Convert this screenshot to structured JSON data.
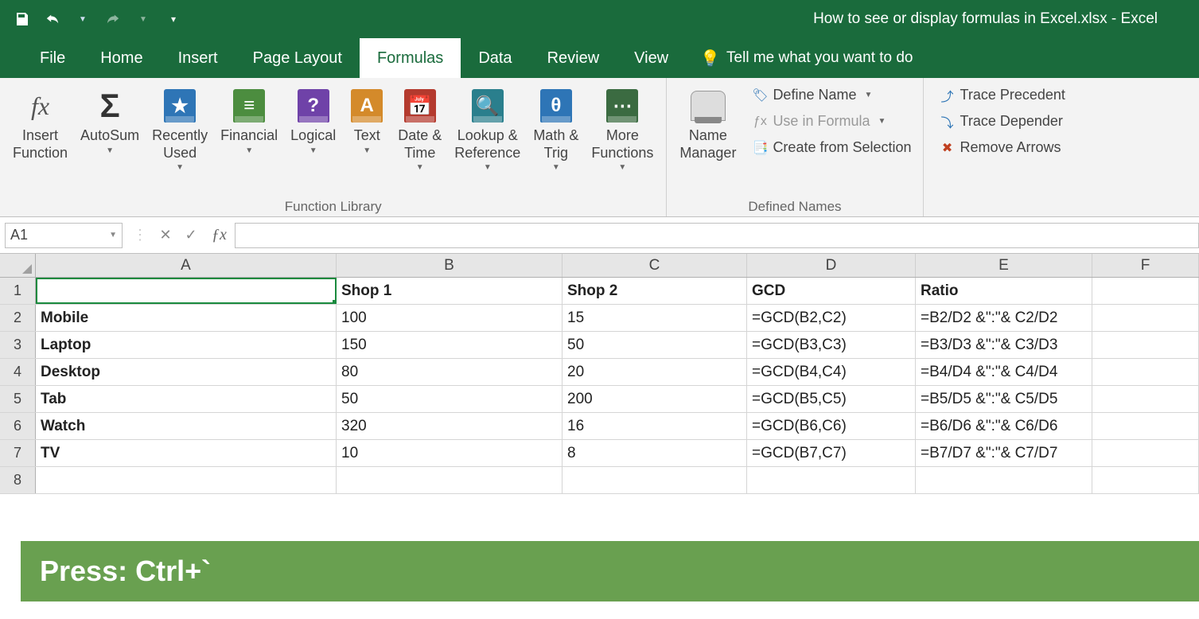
{
  "title": "How to see or display formulas in Excel.xlsx  -  Excel",
  "tabs": [
    "File",
    "Home",
    "Insert",
    "Page Layout",
    "Formulas",
    "Data",
    "Review",
    "View"
  ],
  "active_tab_index": 4,
  "tell_me": "Tell me what you want to do",
  "ribbon": {
    "insert_function": "Insert\nFunction",
    "autosum": "AutoSum",
    "recently_used": "Recently\nUsed",
    "financial": "Financial",
    "logical": "Logical",
    "text": "Text",
    "date_time": "Date &\nTime",
    "lookup": "Lookup &\nReference",
    "math_trig": "Math &\nTrig",
    "more_functions": "More\nFunctions",
    "group_function_library": "Function Library",
    "name_manager": "Name\nManager",
    "define_name": "Define Name",
    "use_in_formula": "Use in Formula",
    "create_from_selection": "Create from Selection",
    "group_defined_names": "Defined Names",
    "trace_precedents": "Trace Precedent",
    "trace_dependents": "Trace Depender",
    "remove_arrows": "Remove Arrows"
  },
  "name_box": "A1",
  "columns": [
    "A",
    "B",
    "C",
    "D",
    "E",
    "F"
  ],
  "rows": [
    {
      "n": "1",
      "cells": [
        "",
        "Shop 1",
        "Shop 2",
        "GCD",
        "Ratio",
        ""
      ],
      "bold": true,
      "selected_col": 0
    },
    {
      "n": "2",
      "cells": [
        "Mobile",
        "100",
        "15",
        "=GCD(B2,C2)",
        "=B2/D2 &\":\"& C2/D2",
        ""
      ],
      "bold_first": true
    },
    {
      "n": "3",
      "cells": [
        "Laptop",
        "150",
        "50",
        "=GCD(B3,C3)",
        "=B3/D3 &\":\"& C3/D3",
        ""
      ],
      "bold_first": true
    },
    {
      "n": "4",
      "cells": [
        "Desktop",
        "80",
        "20",
        "=GCD(B4,C4)",
        "=B4/D4 &\":\"& C4/D4",
        ""
      ],
      "bold_first": true
    },
    {
      "n": "5",
      "cells": [
        "Tab",
        "50",
        "200",
        "=GCD(B5,C5)",
        "=B5/D5 &\":\"& C5/D5",
        ""
      ],
      "bold_first": true
    },
    {
      "n": "6",
      "cells": [
        "Watch",
        "320",
        "16",
        "=GCD(B6,C6)",
        "=B6/D6 &\":\"& C6/D6",
        ""
      ],
      "bold_first": true
    },
    {
      "n": "7",
      "cells": [
        "TV",
        "10",
        "8",
        "=GCD(B7,C7)",
        "=B7/D7 &\":\"& C7/D7",
        ""
      ],
      "bold_first": true
    },
    {
      "n": "8",
      "cells": [
        "",
        "",
        "",
        "",
        "",
        ""
      ]
    }
  ],
  "tip": "Press: Ctrl+`"
}
